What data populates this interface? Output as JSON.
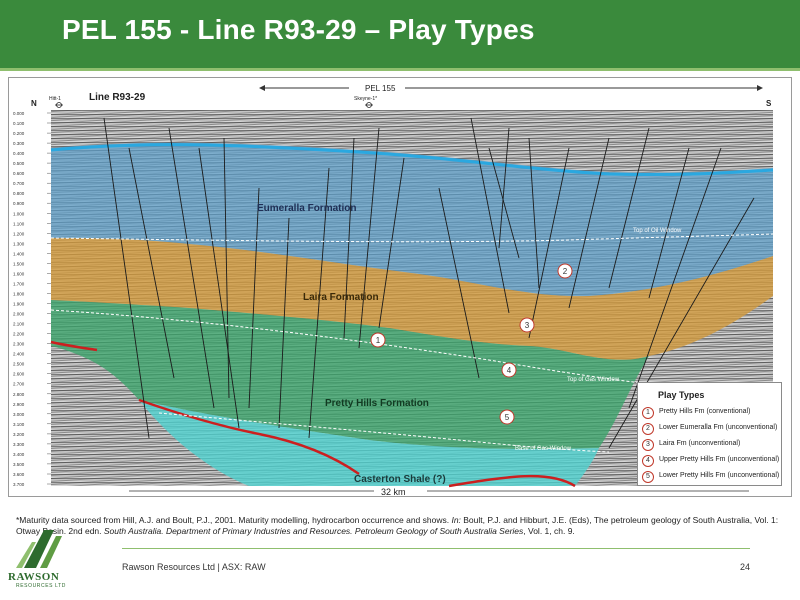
{
  "slide": {
    "title": "PEL 155 - Line R93-29 – Play Types"
  },
  "section": {
    "line_label": "Line R93-29",
    "pel_label": "PEL 155",
    "north": "N",
    "south": "S",
    "well_left": "Hitt-1",
    "well_mid": "Skeyne-1*",
    "distance": "32 km"
  },
  "depth_ticks": [
    "0.000",
    "0.100",
    "0.200",
    "0.300",
    "0.400",
    "0.500",
    "0.600",
    "0.700",
    "0.800",
    "0.900",
    "1.000",
    "1.100",
    "1.200",
    "1.300",
    "1.400",
    "1.500",
    "1.600",
    "1.700",
    "1.800",
    "1.900",
    "2.000",
    "2.100",
    "2.200",
    "2.300",
    "2.400",
    "2.500",
    "2.600",
    "2.700",
    "2.800",
    "2.900",
    "3.000",
    "3.100",
    "3.200",
    "3.300",
    "3.400",
    "3.500",
    "3.600",
    "3.700"
  ],
  "formations": {
    "eumeralla": "Eumeralla Formation",
    "laira": "Laira Formation",
    "pretty_hills": "Pretty Hills Formation",
    "casterton": "Casterton Shale (?)"
  },
  "windows": {
    "oil": "Top of Oil Window",
    "gas_top": "Top of Gas Window",
    "gas_base": "Base of Gas Window"
  },
  "markers": [
    "1",
    "2",
    "3",
    "4",
    "5"
  ],
  "legend": {
    "title": "Play Types",
    "items": [
      {
        "num": "1",
        "label": "Pretty Hills Fm (conventional)"
      },
      {
        "num": "2",
        "label": "Lower Eumeralla Fm (unconventional)"
      },
      {
        "num": "3",
        "label": "Laira Fm (unconventional)"
      },
      {
        "num": "4",
        "label": "Upper Pretty Hills Fm (unconventional)"
      },
      {
        "num": "5",
        "label": "Lower Pretty Hills Fm (unconventional)"
      }
    ]
  },
  "footnote": {
    "text_1": "*Maturity data sourced from Hill, A.J. and Boult, P.J., 2001. Maturity modelling, hydrocarbon occurrence and shows. ",
    "in_1": "In:",
    "text_2": " Boult, P.J. and Hibburt, J.E. (Eds), The petroleum geology of South Australia, Vol. 1: Otway Basin. 2nd edn. ",
    "italic": "South Australia. Department of Primary Industries and Resources. Petroleum Geology of South Australia Series",
    "text_3": ", Vol. 1, ch. 9."
  },
  "footer": {
    "logo_name": "RAWSON",
    "logo_sub": "RESOURCES LTD",
    "company": "Rawson Resources Ltd   |   ASX: RAW",
    "page": "24"
  },
  "colors": {
    "brand_green": "#3a8a3c",
    "eumeralla": "#5b9ec9",
    "laira": "#d49a3a",
    "pretty_hills": "#3aa46a",
    "casterton": "#4fd2cf",
    "marker_red": "#c0392b"
  }
}
